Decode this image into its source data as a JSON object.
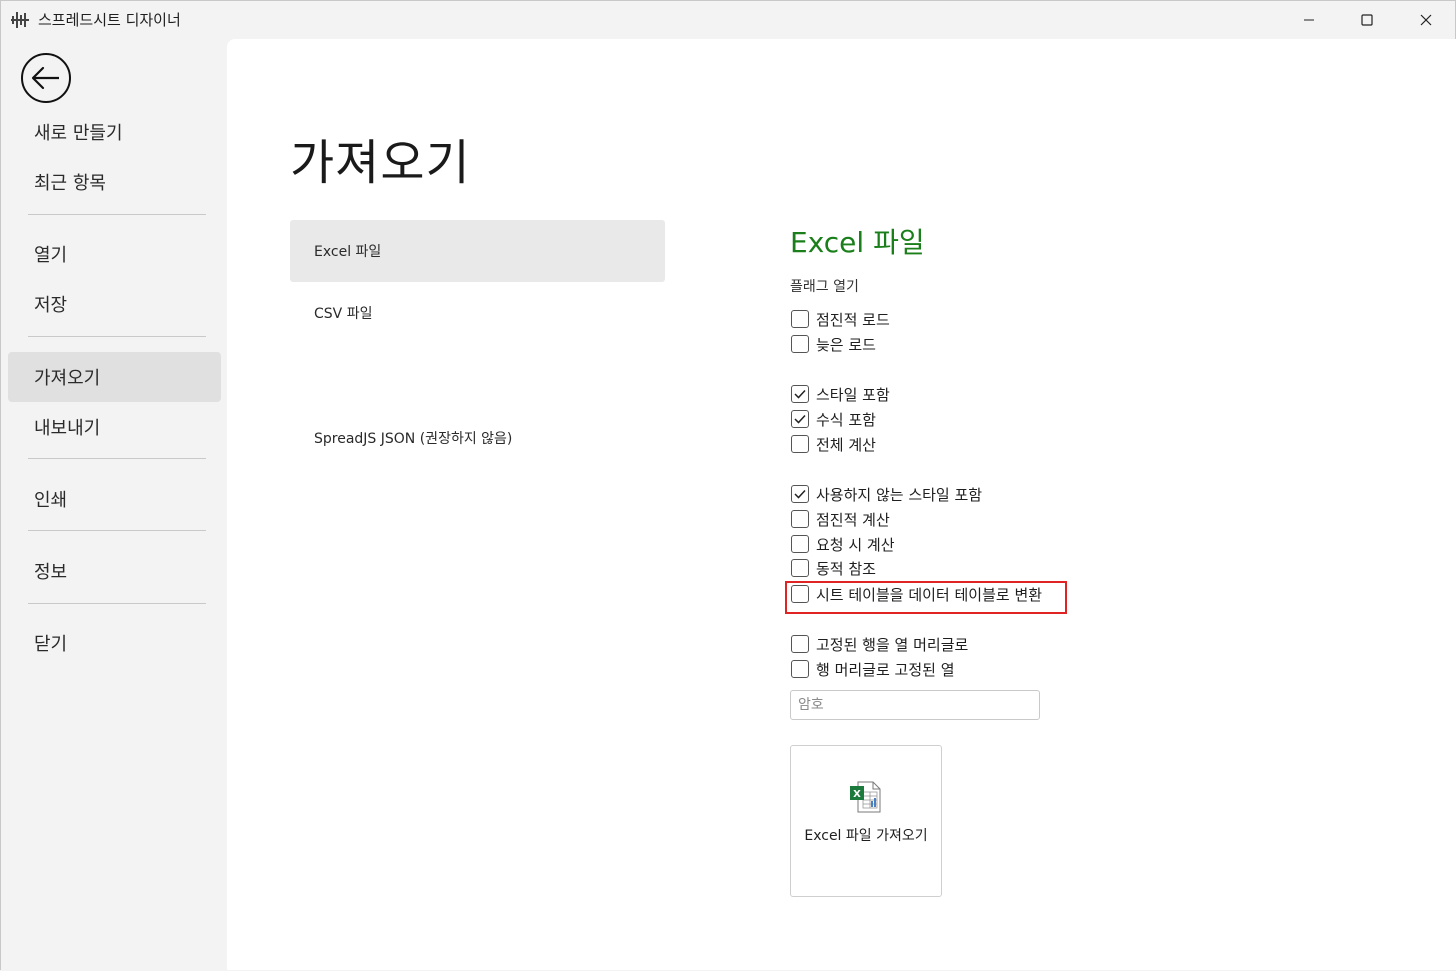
{
  "window": {
    "title": "스프레드시트 디자이너"
  },
  "sidebar": {
    "items": [
      {
        "label": "새로 만들기"
      },
      {
        "label": "최근 항목"
      },
      {
        "label": "열기"
      },
      {
        "label": "저장"
      },
      {
        "label": "가져오기",
        "active": true
      },
      {
        "label": "내보내기"
      },
      {
        "label": "인쇄"
      },
      {
        "label": "정보"
      },
      {
        "label": "닫기"
      }
    ]
  },
  "main": {
    "title": "가져오기",
    "import_types": [
      {
        "label": "Excel 파일",
        "active": true
      },
      {
        "label": "CSV 파일"
      },
      {
        "label": "SpreadJS JSON (권장하지 않음)"
      }
    ],
    "section_title": "Excel 파일",
    "group_label": "플래그 열기",
    "options": [
      {
        "label": "점진적 로드",
        "checked": false
      },
      {
        "label": "늦은 로드",
        "checked": false
      },
      {
        "label": "스타일 포함",
        "checked": true
      },
      {
        "label": "수식 포함",
        "checked": true
      },
      {
        "label": "전체 계산",
        "checked": false
      },
      {
        "label": "사용하지 않는 스타일 포함",
        "checked": true
      },
      {
        "label": "점진적 계산",
        "checked": false
      },
      {
        "label": "요청 시 계산",
        "checked": false
      },
      {
        "label": "동적 참조",
        "checked": false
      },
      {
        "label": "시트 테이블을 데이터 테이블로 변환",
        "checked": false
      },
      {
        "label": "고정된 행을 열 머리글로",
        "checked": false
      },
      {
        "label": "행 머리글로 고정된 열",
        "checked": false
      }
    ],
    "password_placeholder": "암호",
    "import_button_label": "Excel 파일 가져오기"
  },
  "colors": {
    "accent_green": "#1a7f1a",
    "highlight_red": "#e02424"
  }
}
